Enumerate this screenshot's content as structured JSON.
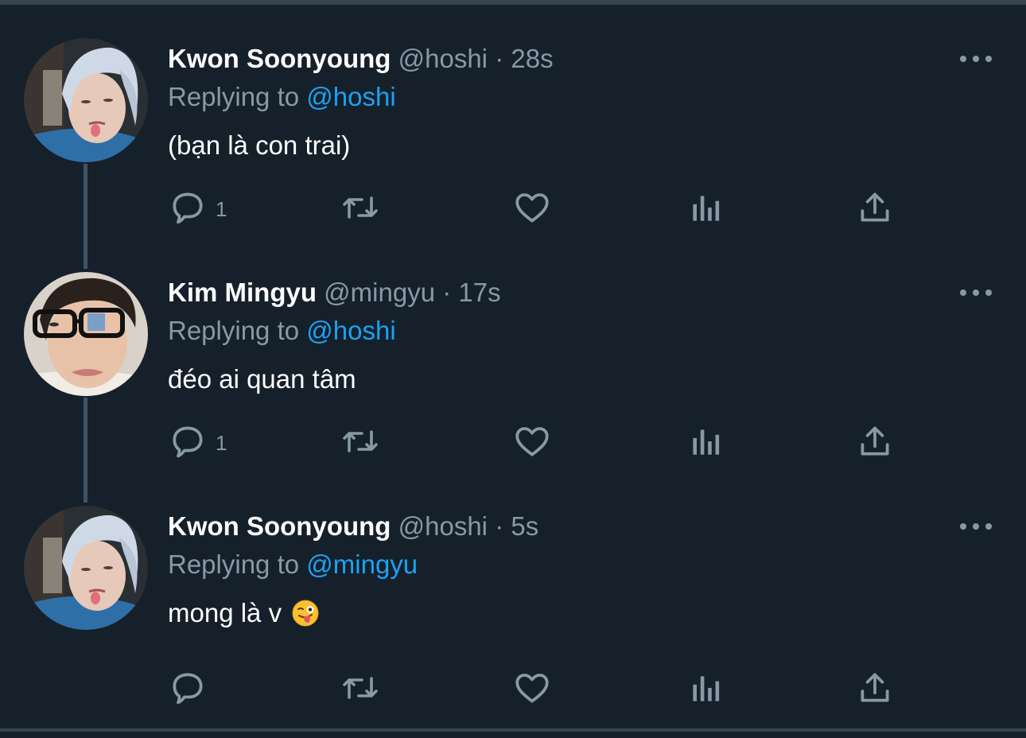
{
  "colors": {
    "background": "#15202b",
    "divider": "#38444d",
    "thread_line": "#3d5466",
    "muted_text": "#8899a6",
    "link": "#1da1f2",
    "primary_text": "#ffffff"
  },
  "tweets": [
    {
      "display_name": "Kwon Soonyoung",
      "handle": "@hoshi",
      "separator": "·",
      "time": "28s",
      "replying_prefix": "Replying to",
      "replying_to": "@hoshi",
      "text": "(bạn là con trai)",
      "reply_count": "1",
      "avatar": "silver-hair-avatar"
    },
    {
      "display_name": "Kim Mingyu",
      "handle": "@mingyu",
      "separator": "·",
      "time": "17s",
      "replying_prefix": "Replying to",
      "replying_to": "@hoshi",
      "text": "đéo ai quan tâm",
      "reply_count": "1",
      "avatar": "glasses-avatar"
    },
    {
      "display_name": "Kwon Soonyoung",
      "handle": "@hoshi",
      "separator": "·",
      "time": "5s",
      "replying_prefix": "Replying to",
      "replying_to": "@mingyu",
      "text": "mong là v",
      "emoji": "winking-face-with-tongue-emoji",
      "reply_count": "",
      "avatar": "silver-hair-avatar"
    }
  ],
  "icons": {
    "reply": "reply-icon",
    "retweet": "retweet-icon",
    "like": "like-icon",
    "analytics": "analytics-icon",
    "share": "share-icon",
    "more": "more-options-icon"
  }
}
